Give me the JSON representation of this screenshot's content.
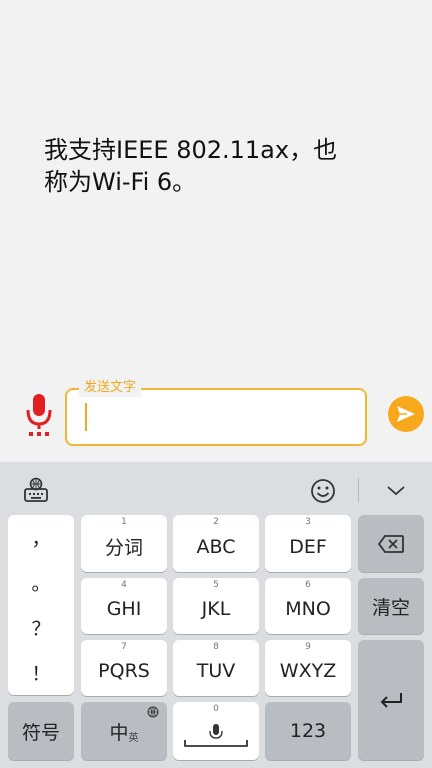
{
  "message": {
    "line1": "我支持IEEE 802.11ax，也",
    "line2": "称为Wi-Fi 6。"
  },
  "input": {
    "label": "发送文字",
    "value": ""
  },
  "icons": {
    "mic": "microphone-icon",
    "send": "send-arrow-icon",
    "keyboard_settings": "keyboard-settings-icon",
    "emoji": "emoji-icon",
    "collapse": "chevron-down-icon",
    "backspace": "backspace-icon",
    "enter": "enter-icon",
    "globe": "globe-icon",
    "voice": "voice-mic-icon"
  },
  "colors": {
    "accent": "#f7a81b",
    "mic": "#e02020"
  },
  "keyboard": {
    "punct": [
      "，",
      "。",
      "？",
      "！"
    ],
    "row1": [
      {
        "num": "1",
        "label": "分词"
      },
      {
        "num": "2",
        "label": "ABC"
      },
      {
        "num": "3",
        "label": "DEF"
      }
    ],
    "row2": [
      {
        "num": "4",
        "label": "GHI"
      },
      {
        "num": "5",
        "label": "JKL"
      },
      {
        "num": "6",
        "label": "MNO"
      }
    ],
    "row3": [
      {
        "num": "7",
        "label": "PQRS"
      },
      {
        "num": "8",
        "label": "TUV"
      },
      {
        "num": "9",
        "label": "WXYZ"
      }
    ],
    "clear": "清空",
    "symbols": "符号",
    "chinese": "中",
    "chinese_sub": "英",
    "space_num": "0",
    "numbers": "123"
  }
}
